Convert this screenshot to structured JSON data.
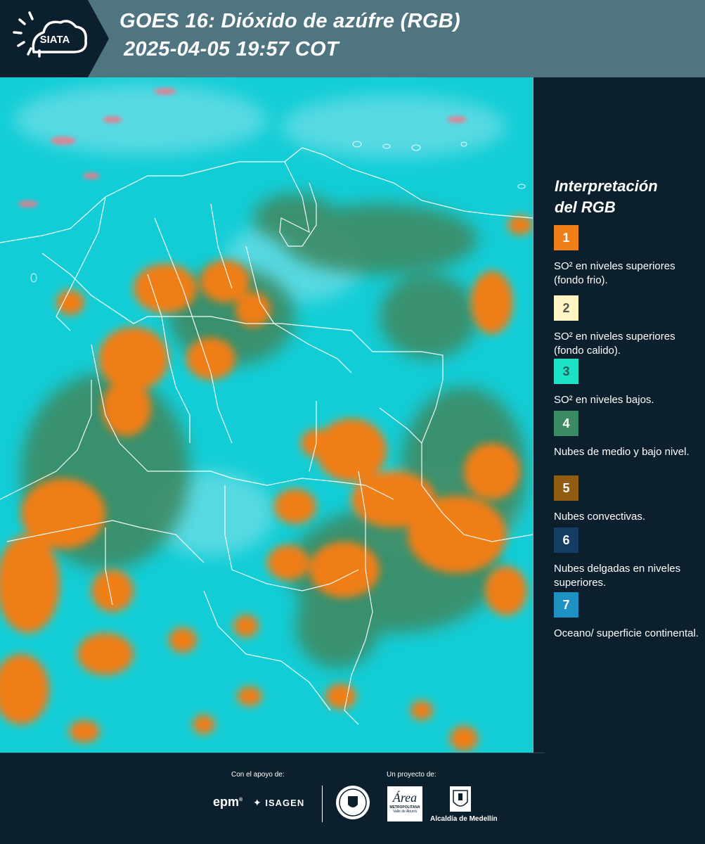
{
  "header": {
    "logo_text": "SIATA",
    "title_line1": "GOES 16: Dióxido de azúfre (RGB)",
    "title_line2": "2025-04-05 19:57 COT"
  },
  "legend": {
    "title_line1": "Interpretación",
    "title_line2": "del RGB",
    "items": [
      {
        "number": "1",
        "color": "#f07e19",
        "text_color": "#ffffff",
        "desc": "SO² en niveles superiores (fondo frio)."
      },
      {
        "number": "2",
        "color": "#fff6c4",
        "text_color": "#555555",
        "desc": "SO² en niveles superiores (fondo calido)."
      },
      {
        "number": "3",
        "color": "#1de3c6",
        "text_color": "#2f5a55",
        "desc": "SO² en niveles bajos."
      },
      {
        "number": "4",
        "color": "#3c8a63",
        "text_color": "#ffffff",
        "desc": "Nubes de medio y bajo nivel."
      },
      {
        "number": "5",
        "color": "#8f5c12",
        "text_color": "#ffffff",
        "desc": "Nubes convectivas."
      },
      {
        "number": "6",
        "color": "#143d63",
        "text_color": "#ffffff",
        "desc": "Nubes delgadas en niveles superiores."
      },
      {
        "number": "7",
        "color": "#1d90c4",
        "text_color": "#ffffff",
        "desc": "Oceano/ superficie continental."
      }
    ]
  },
  "footer": {
    "support_label": "Con el apoyo de:",
    "project_label": "Un proyecto de:",
    "epm": "epm",
    "isagen": "ISAGEN",
    "area_name": "Área",
    "area_sub1": "METROPOLITANA",
    "area_sub2": "Valle de Aburrá",
    "alcaldia": "Alcaldía de Medellín"
  },
  "colors": {
    "ocean": "#12d0d8",
    "cloud_orange": "#f07e19",
    "green_land": "#3c8a63",
    "border": "#ffffff"
  }
}
